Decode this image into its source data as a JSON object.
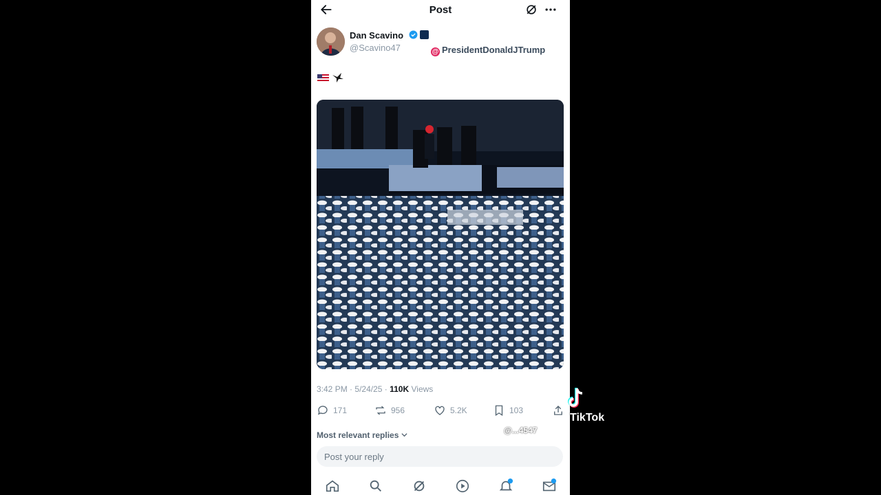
{
  "header": {
    "title": "Post"
  },
  "author": {
    "name": "Dan Scavino",
    "handle": "@Scavino47"
  },
  "mention": "PresidentDonaldJTrump",
  "post": {
    "emoji_text": [
      "flag-us-icon",
      "eagle-icon"
    ]
  },
  "meta": {
    "time": "3:42 PM",
    "date": "5/24/25",
    "views_count": "110K",
    "views_label": "Views",
    "sep": "·"
  },
  "actions": {
    "replies": "171",
    "reposts": "956",
    "likes": "5.2K",
    "bookmarks": "103"
  },
  "replies": {
    "sort_label": "Most relevant replies"
  },
  "reply_box": {
    "placeholder": "Post your reply"
  },
  "watermark": {
    "brand": "TikTok",
    "user_id": "@...4547"
  },
  "colors": {
    "accent": "#1d9bf0",
    "text": "#0f1419",
    "muted": "#8b98a5"
  }
}
